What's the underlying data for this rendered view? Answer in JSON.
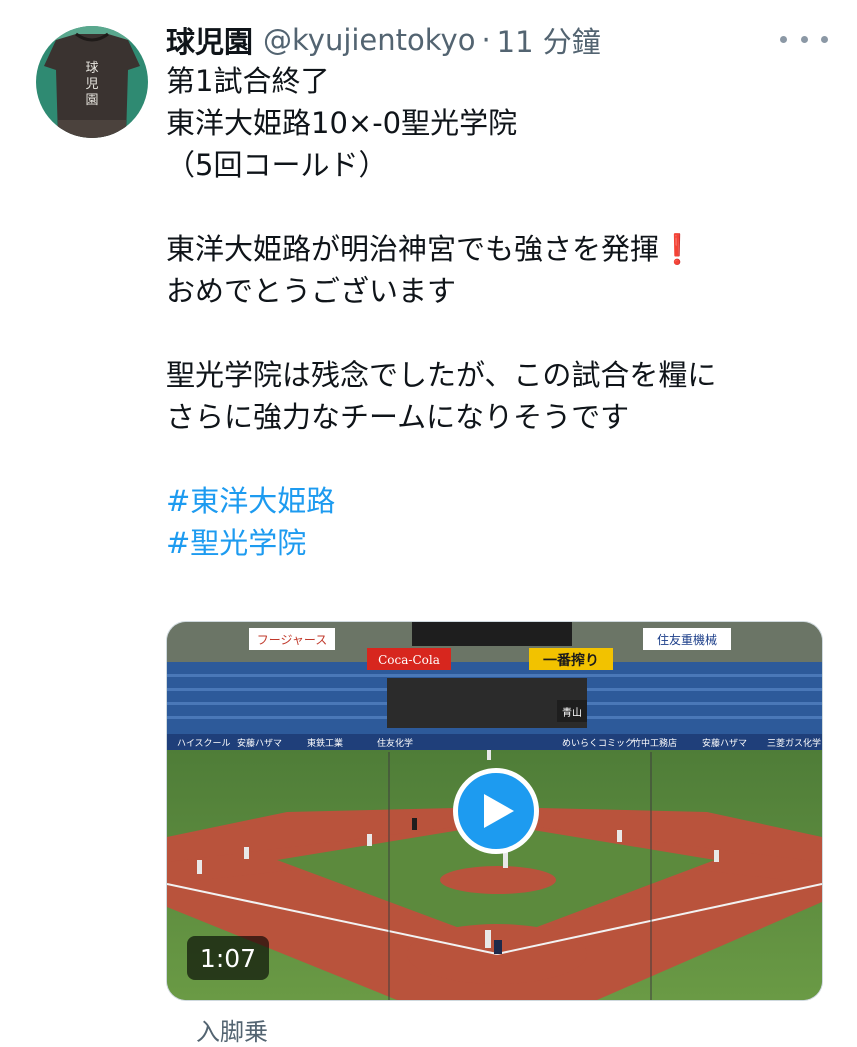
{
  "tweet": {
    "display_name": "球児園",
    "handle": "@kyujientokyo",
    "separator": "·",
    "time": "11 分鐘",
    "lines": [
      "第1試合終了",
      "東洋大姫路10×-0聖光学院",
      "（5回コールド）",
      "",
      "東洋大姫路が明治神宮でも強さを発揮",
      "おめでとうございます",
      "",
      "聖光学院は残念でしたが、この試合を糧に",
      "さらに強力なチームになりそうです",
      ""
    ],
    "emphasis": "❗",
    "hashtags": [
      "#東洋大姫路",
      "#聖光学院"
    ],
    "avatar_text": "球\n児\n園",
    "cut_off_text": "入脚乗"
  },
  "media": {
    "duration": "1:07",
    "stadium_signs": [
      "フージャース",
      "Coca-Cola",
      "一番搾り",
      "住友重機械",
      "青山",
      "東鉄工業",
      "住友化学",
      "竹中工務店",
      "安藤ハザマ",
      "三菱ガス化学",
      "めいらくコミック",
      "ハイスクール"
    ]
  },
  "colors": {
    "link": "#1d9bf0",
    "secondary_text": "#536471",
    "field_green": "#5c8a3d",
    "infield_dirt": "#b9533c"
  },
  "icons": {
    "more": "more-icon",
    "play": "play-icon"
  }
}
